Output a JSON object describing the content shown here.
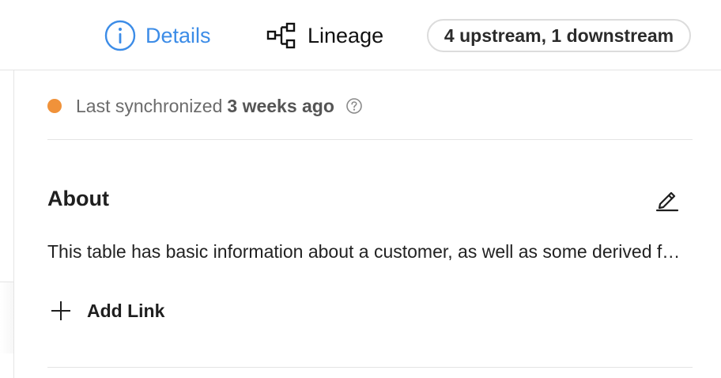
{
  "header": {
    "tabs": [
      {
        "label": "Details",
        "icon": "info-circle-icon",
        "active": true
      },
      {
        "label": "Lineage",
        "icon": "lineage-graph-icon",
        "active": false
      }
    ],
    "lineage_summary": "4 upstream, 1 downstream"
  },
  "sync": {
    "label": "Last synchronized",
    "value": "3 weeks ago",
    "status_color": "#f0923a",
    "help_icon": "help-circle-icon"
  },
  "about": {
    "title": "About",
    "edit_icon": "pencil-edit-icon",
    "description": "This table has basic information about a customer, as well as some derived facts based on a customer's orders",
    "add_link_label": "Add Link",
    "add_link_icon": "plus-icon"
  },
  "colors": {
    "accent": "#3c8ce7",
    "status_warning": "#f0923a",
    "divider": "#e4e4e4"
  }
}
